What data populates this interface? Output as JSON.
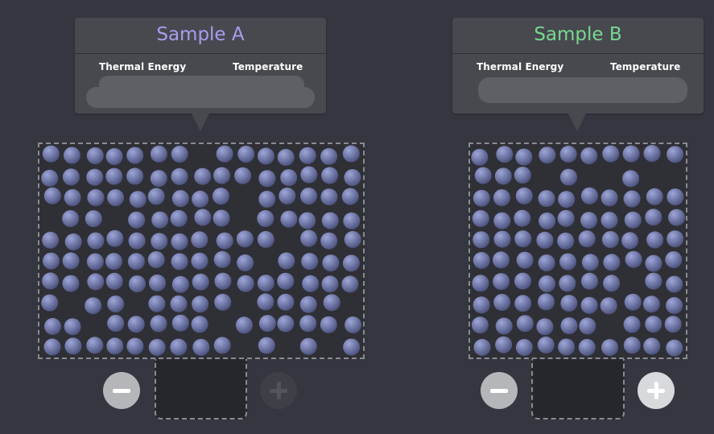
{
  "samples": [
    {
      "title": "Sample A",
      "title_color": "#a99cf0",
      "col1": "Thermal Energy",
      "col2": "Temperature",
      "minus_enabled": true,
      "plus_enabled": false
    },
    {
      "title": "Sample B",
      "title_color": "#78d88f",
      "col1": "Thermal Energy",
      "col2": "Temperature",
      "minus_enabled": true,
      "plus_enabled": true
    }
  ],
  "particles": {
    "color_light": "#9ea6d8",
    "color_dark": "#4f5682"
  },
  "icons": {
    "minus": "minus-icon",
    "plus": "plus-icon"
  }
}
